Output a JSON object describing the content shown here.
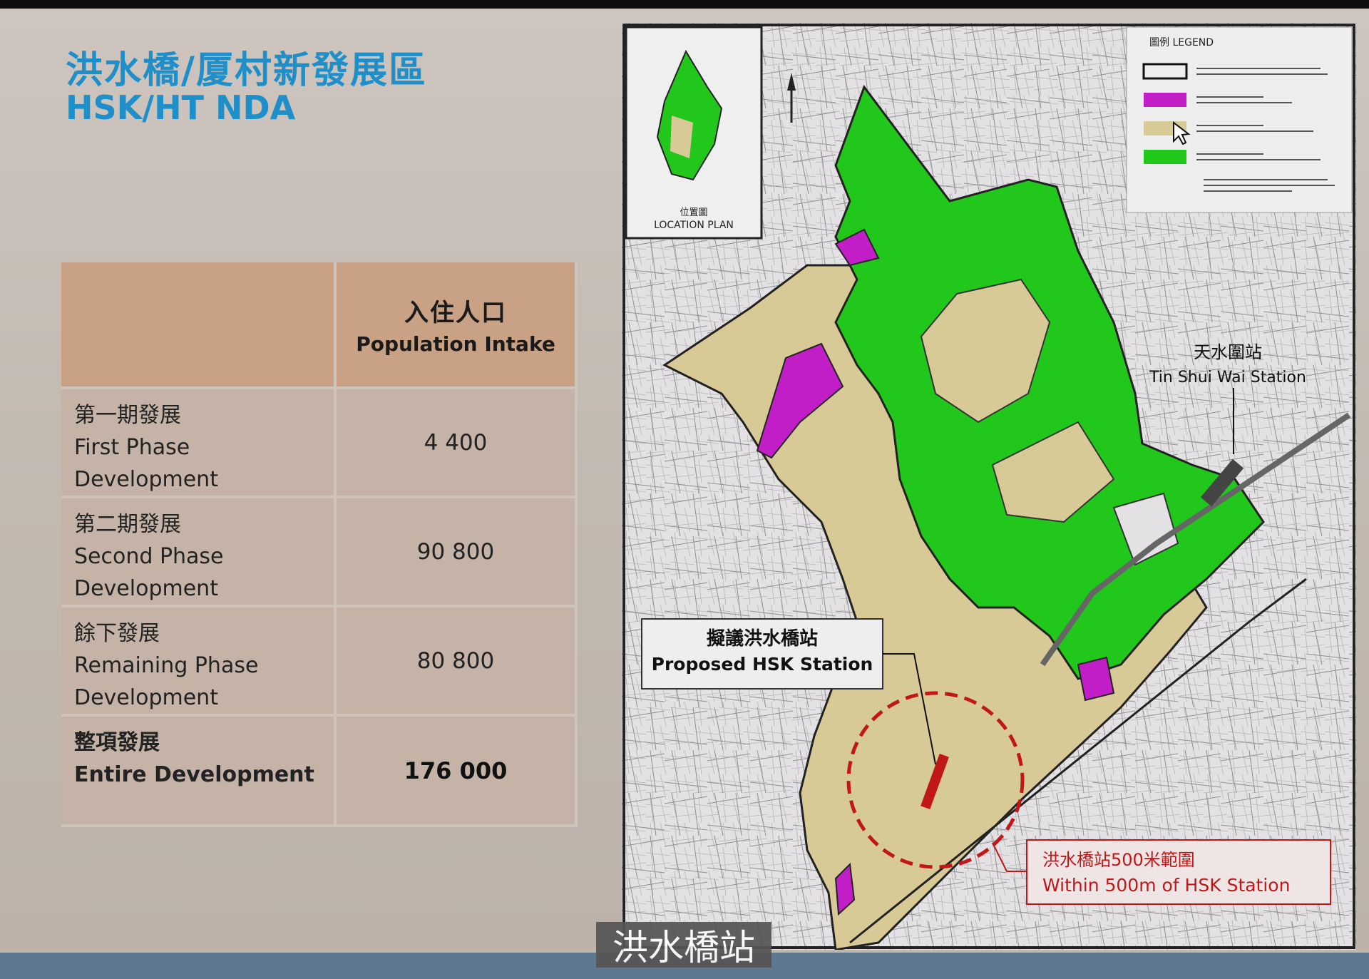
{
  "slide": {
    "title_zh": "洪水橋/厦村新發展區",
    "title_en": "HSK/HT NDA"
  },
  "table": {
    "header": {
      "zh": "入住人口",
      "en": "Population Intake"
    },
    "rows": [
      {
        "zh": "第一期發展",
        "en1": "First Phase",
        "en2": "Development",
        "value": "4 400"
      },
      {
        "zh": "第二期發展",
        "en1": "Second Phase",
        "en2": "Development",
        "value": "90 800"
      },
      {
        "zh": "餘下發展",
        "en1": "Remaining Phase",
        "en2": "Development",
        "value": "80 800"
      }
    ],
    "total": {
      "zh": "整項發展",
      "en": "Entire Development",
      "value": "176 000"
    }
  },
  "map": {
    "legend_title": "圖例 LEGEND",
    "location_plan": {
      "zh": "位置圖",
      "en": "LOCATION PLAN"
    },
    "tsw_station": {
      "zh": "天水圍站",
      "en": "Tin Shui Wai Station"
    },
    "hsk_station": {
      "zh": "擬議洪水橋站",
      "en": "Proposed HSK Station"
    },
    "radius_note": {
      "zh": "洪水橋站500米範圍",
      "en": "Within 500m of HSK Station"
    },
    "colors": {
      "first_phase": "#c21ec7",
      "second_phase": "#d8ca96",
      "remaining_phase": "#22c71c",
      "boundary": "#111111",
      "radius": "#c01818"
    },
    "icons": [
      "north-arrow-icon",
      "cursor-arrow-icon"
    ]
  },
  "subtitle": {
    "text": "洪水橋站"
  }
}
